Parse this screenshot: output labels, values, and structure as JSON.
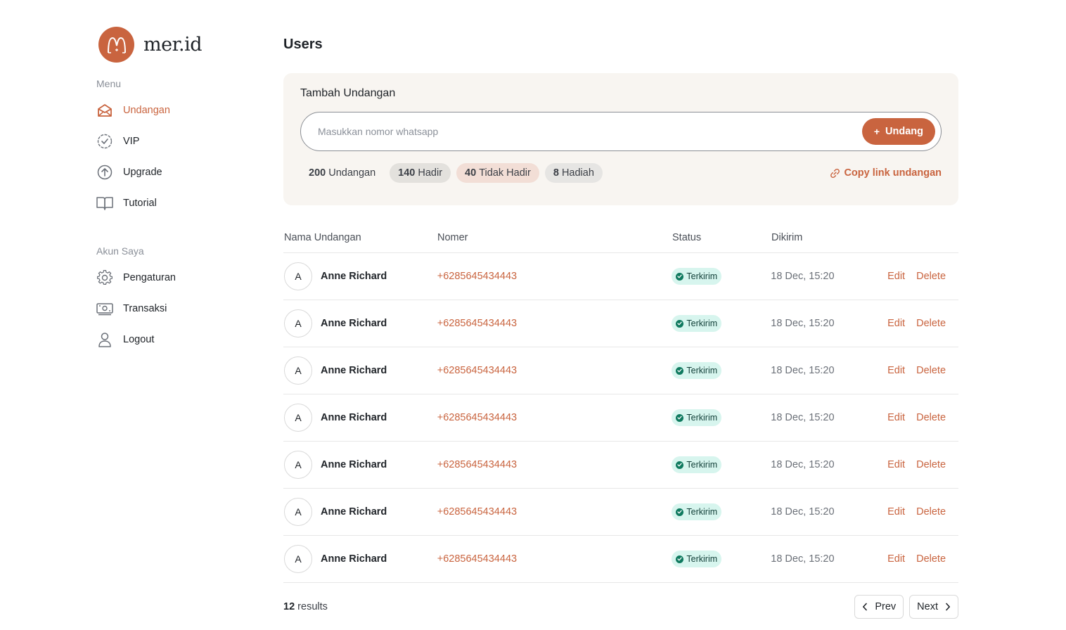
{
  "brand": {
    "name": "mer.id",
    "logo_icon": "mer-logo-icon"
  },
  "sidebar": {
    "menu_label": "Menu",
    "menu_items": [
      {
        "label": "Undangan",
        "icon": "envelope-icon",
        "active": true
      },
      {
        "label": "VIP",
        "icon": "badge-check-icon",
        "active": false
      },
      {
        "label": "Upgrade",
        "icon": "arrow-up-circle-icon",
        "active": false
      },
      {
        "label": "Tutorial",
        "icon": "book-icon",
        "active": false
      }
    ],
    "account_label": "Akun Saya",
    "account_items": [
      {
        "label": "Pengaturan",
        "icon": "gear-icon"
      },
      {
        "label": "Transaksi",
        "icon": "money-icon"
      },
      {
        "label": "Logout",
        "icon": "user-icon"
      }
    ]
  },
  "page": {
    "title": "Users"
  },
  "invite": {
    "title": "Tambah Undangan",
    "placeholder": "Masukkan nomor whatsapp",
    "button_plus": "+",
    "button_label": "Undang",
    "stats": {
      "total_count": "200",
      "total_label": "Undangan",
      "hadir_count": "140",
      "hadir_label": "Hadir",
      "tidak_count": "40",
      "tidak_label": "Tidak Hadir",
      "hadiah_count": "8",
      "hadiah_label": "Hadiah"
    },
    "copy_link_label": "Copy link undangan"
  },
  "table": {
    "headers": {
      "name": "Nama Undangan",
      "number": "Nomer",
      "status": "Status",
      "sent": "Dikirim"
    },
    "rows": [
      {
        "initial": "A",
        "name": "Anne Richard",
        "phone": "+6285645434443",
        "status": "Terkirim",
        "sent": "18 Dec, 15:20",
        "edit": "Edit",
        "delete": "Delete"
      },
      {
        "initial": "A",
        "name": "Anne Richard",
        "phone": "+6285645434443",
        "status": "Terkirim",
        "sent": "18 Dec, 15:20",
        "edit": "Edit",
        "delete": "Delete"
      },
      {
        "initial": "A",
        "name": "Anne Richard",
        "phone": "+6285645434443",
        "status": "Terkirim",
        "sent": "18 Dec, 15:20",
        "edit": "Edit",
        "delete": "Delete"
      },
      {
        "initial": "A",
        "name": "Anne Richard",
        "phone": "+6285645434443",
        "status": "Terkirim",
        "sent": "18 Dec, 15:20",
        "edit": "Edit",
        "delete": "Delete"
      },
      {
        "initial": "A",
        "name": "Anne Richard",
        "phone": "+6285645434443",
        "status": "Terkirim",
        "sent": "18 Dec, 15:20",
        "edit": "Edit",
        "delete": "Delete"
      },
      {
        "initial": "A",
        "name": "Anne Richard",
        "phone": "+6285645434443",
        "status": "Terkirim",
        "sent": "18 Dec, 15:20",
        "edit": "Edit",
        "delete": "Delete"
      },
      {
        "initial": "A",
        "name": "Anne Richard",
        "phone": "+6285645434443",
        "status": "Terkirim",
        "sent": "18 Dec, 15:20",
        "edit": "Edit",
        "delete": "Delete"
      }
    ]
  },
  "footer": {
    "results_count": "12",
    "results_label": "results",
    "prev_label": "Prev",
    "next_label": "Next"
  },
  "colors": {
    "accent": "#c9643f",
    "card_bg": "#f8f5f1",
    "status_bg": "#d7f5ee",
    "status_dot": "#0f7a5f"
  }
}
